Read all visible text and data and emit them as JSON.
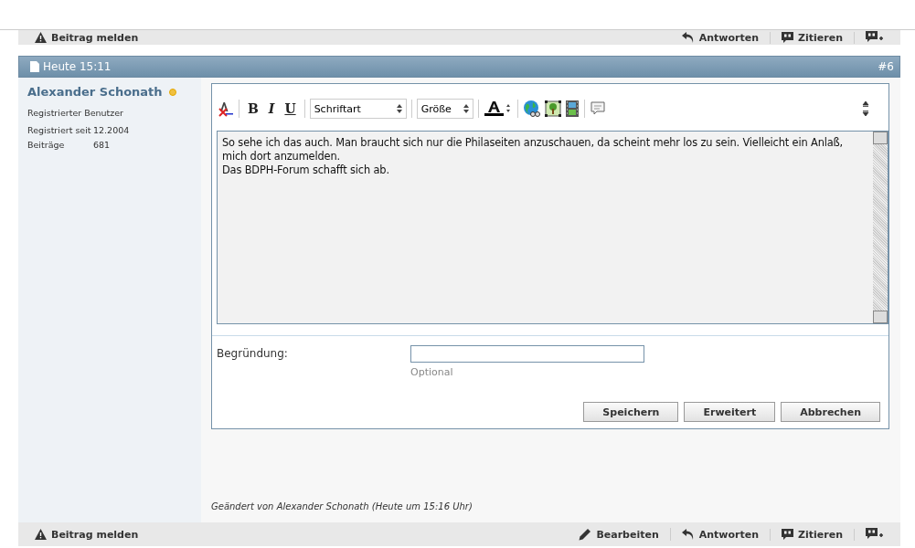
{
  "top_bar": {
    "report": "Beitrag melden",
    "actions": [
      {
        "kind": "reply",
        "label": "Antworten"
      },
      {
        "kind": "quote",
        "label": "Zitieren"
      },
      {
        "kind": "multiquote"
      }
    ]
  },
  "post": {
    "date": "Heute 15:11",
    "number": "#6",
    "author": {
      "name": "Alexander Schonath",
      "online": true,
      "title": "Registrierter Benutzer",
      "stats": [
        {
          "label": "Registriert seit",
          "value": "12.2004"
        },
        {
          "label": "Beiträge",
          "value": "681"
        }
      ]
    },
    "editor": {
      "toolbar": [
        {
          "kind": "removeformat"
        },
        {
          "kind": "sep"
        },
        {
          "kind": "bold",
          "label": "B"
        },
        {
          "kind": "italic",
          "label": "I"
        },
        {
          "kind": "underline",
          "label": "U"
        },
        {
          "kind": "sep"
        },
        {
          "kind": "select",
          "label": "Schriftart"
        },
        {
          "kind": "sep"
        },
        {
          "kind": "select",
          "label": "Größe"
        },
        {
          "kind": "sep"
        },
        {
          "kind": "color"
        },
        {
          "kind": "sep"
        },
        {
          "kind": "link"
        },
        {
          "kind": "image"
        },
        {
          "kind": "video"
        },
        {
          "kind": "sep"
        },
        {
          "kind": "quote"
        }
      ],
      "text": [
        "So sehe ich das auch. Man braucht sich nur die Philaseiten anzuschauen, da scheint mehr los zu sein.  Vielleicht ein Anlaß, mich dort anzumelden.",
        "Das BDPH-Forum schafft sich ab."
      ],
      "reason_label": "Begründung:",
      "reason_hint": "Optional",
      "buttons": [
        "Speichern",
        "Erweitert",
        "Abbrechen"
      ]
    },
    "edited_note": "Geändert von Alexander Schonath (Heute um 15:16 Uhr)",
    "actions": [
      {
        "kind": "edit",
        "label": "Bearbeiten"
      },
      {
        "kind": "reply",
        "label": "Antworten"
      },
      {
        "kind": "quote",
        "label": "Zitieren"
      },
      {
        "kind": "multiquote"
      }
    ],
    "report": "Beitrag melden"
  }
}
